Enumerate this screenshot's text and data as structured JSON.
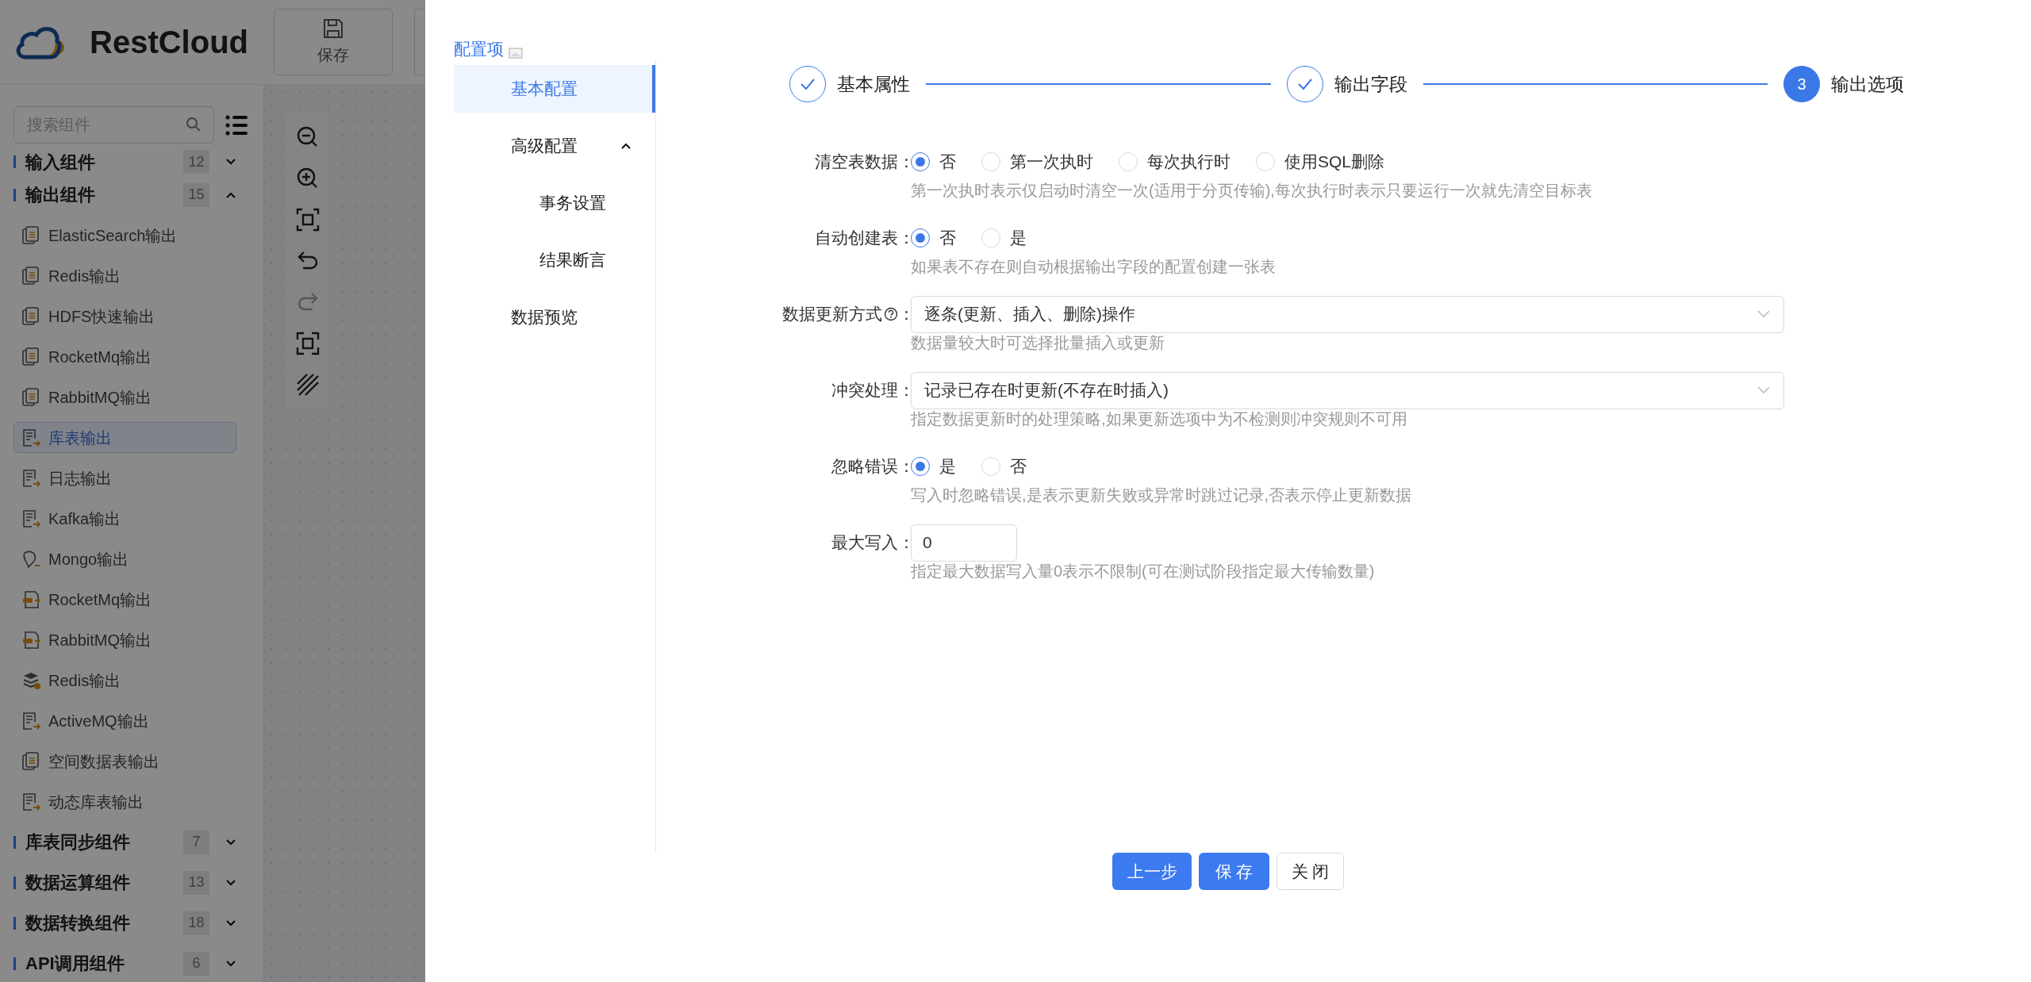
{
  "app": {
    "logo_text": "RestCloud",
    "toolbar": [
      {
        "label": "保存"
      }
    ]
  },
  "sidebar": {
    "search": {
      "placeholder": "搜索组件"
    },
    "groups": [
      {
        "title": "输入组件",
        "count": "12",
        "expanded": false
      },
      {
        "title": "输出组件",
        "count": "15",
        "expanded": true,
        "items": [
          {
            "label": "ElasticSearch输出",
            "kind": "doc",
            "selected": false
          },
          {
            "label": "Redis输出",
            "kind": "doc",
            "selected": false
          },
          {
            "label": "HDFS快速输出",
            "kind": "doc",
            "selected": false
          },
          {
            "label": "RocketMq输出",
            "kind": "doc",
            "selected": false
          },
          {
            "label": "RabbitMQ输出",
            "kind": "doc",
            "selected": false
          },
          {
            "label": "库表输出",
            "kind": "sheet",
            "selected": true
          },
          {
            "label": "日志输出",
            "kind": "sheet",
            "selected": false
          },
          {
            "label": "Kafka输出",
            "kind": "sheet",
            "selected": false
          },
          {
            "label": "Mongo输出",
            "kind": "leaf",
            "selected": false
          },
          {
            "label": "RocketMq输出",
            "kind": "mq",
            "selected": false
          },
          {
            "label": "RabbitMQ输出",
            "kind": "mq",
            "selected": false
          },
          {
            "label": "Redis输出",
            "kind": "stack",
            "selected": false
          },
          {
            "label": "ActiveMQ输出",
            "kind": "sheet",
            "selected": false
          },
          {
            "label": "空间数据表输出",
            "kind": "doc",
            "selected": false
          },
          {
            "label": "动态库表输出",
            "kind": "sheet",
            "selected": false
          }
        ]
      },
      {
        "title": "库表同步组件",
        "count": "7",
        "expanded": false
      },
      {
        "title": "数据运算组件",
        "count": "13",
        "expanded": false
      },
      {
        "title": "数据转换组件",
        "count": "18",
        "expanded": false
      },
      {
        "title": "API调用组件",
        "count": "6",
        "expanded": false
      }
    ]
  },
  "canvas_tools": [
    {
      "kind": "zoom-out",
      "disabled": false
    },
    {
      "kind": "zoom-in",
      "disabled": false
    },
    {
      "kind": "fit",
      "disabled": false
    },
    {
      "kind": "undo",
      "disabled": false
    },
    {
      "kind": "redo",
      "disabled": true
    },
    {
      "kind": "fullscreen",
      "disabled": false
    },
    {
      "kind": "hatch",
      "disabled": false
    }
  ],
  "drawer": {
    "menu_title": "配置项",
    "menu": [
      {
        "label": "基本配置",
        "selected": true
      },
      {
        "label": "高级配置",
        "selected": false,
        "expanded": true,
        "children": [
          {
            "label": "事务设置",
            "selected": false
          },
          {
            "label": "结果断言",
            "selected": false
          }
        ]
      },
      {
        "label": "数据预览",
        "selected": false
      }
    ],
    "steps": [
      {
        "label": "基本属性",
        "done": true
      },
      {
        "label": "输出字段",
        "done": true
      },
      {
        "number": "3",
        "label": "输出选项",
        "done": false
      }
    ],
    "fields": [
      {
        "label": "清空表数据",
        "colon": "：",
        "info": false,
        "kind": "radio",
        "options": [
          {
            "label": "否",
            "selected": true
          },
          {
            "label": "第一次执时",
            "selected": false
          },
          {
            "label": "每次执行时",
            "selected": false
          },
          {
            "label": "使用SQL删除",
            "selected": false
          }
        ],
        "help": "第一次执时表示仅启动时清空一次(适用于分页传输),每次执行时表示只要运行一次就先清空目标表"
      },
      {
        "label": "自动创建表",
        "colon": "：",
        "info": false,
        "kind": "radio",
        "options": [
          {
            "label": "否",
            "selected": true
          },
          {
            "label": "是",
            "selected": false
          }
        ],
        "help": "如果表不存在则自动根据输出字段的配置创建一张表"
      },
      {
        "label": "数据更新方式",
        "colon": "：",
        "info": true,
        "kind": "select",
        "value": "逐条(更新、插入、删除)操作",
        "help": "数据量较大时可选择批量插入或更新"
      },
      {
        "label": "冲突处理",
        "colon": "：",
        "info": false,
        "kind": "select",
        "value": "记录已存在时更新(不存在时插入)",
        "help": "指定数据更新时的处理策略,如果更新选项中为不检测则冲突规则不可用"
      },
      {
        "label": "忽略错误",
        "colon": "：",
        "info": false,
        "kind": "radio",
        "options": [
          {
            "label": "是",
            "selected": true
          },
          {
            "label": "否",
            "selected": false
          }
        ],
        "help": "写入时忽略错误,是表示更新失败或异常时跳过记录,否表示停止更新数据"
      },
      {
        "label": "最大写入",
        "colon": "：",
        "info": false,
        "kind": "input",
        "value": "0",
        "help": "指定最大数据写入量0表示不限制(可在测试阶段指定最大传输数量)"
      }
    ],
    "buttons": [
      {
        "label": "上一步",
        "kind": "primary"
      },
      {
        "label": "保 存",
        "kind": "primary"
      },
      {
        "label": "关 闭",
        "kind": "default"
      }
    ]
  }
}
